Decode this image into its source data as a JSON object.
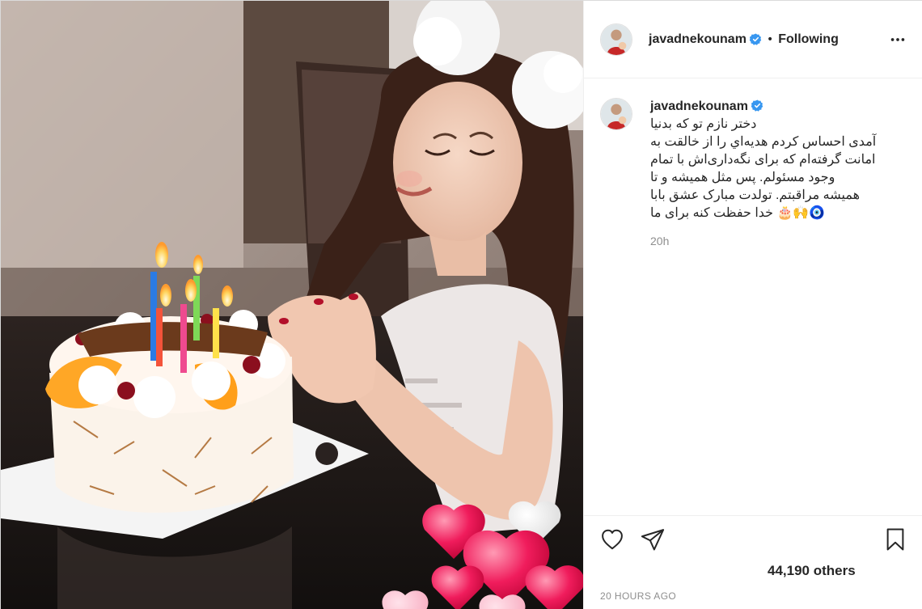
{
  "post": {
    "username": "javadnekounam",
    "header_separator": "•",
    "follow_state": "Following",
    "more_icon": "more-horizontal-icon",
    "verified_icon": "verified-badge-icon",
    "caption": {
      "username": "javadnekounam",
      "lines": [
        "دختر نازم تو که بدنیا",
        "آمدی احساس کردم هدیه‌اي را از خالقت به",
        "امانت گرفته‌ام که برای نگه‌داری‌اش با تمام",
        "وجود مسئولم. پس مثل همیشه و تا",
        "همیشه مراقبتم. تولدت مبارک عشق بابا",
        "🧿🙌🎂 خدا حفظت کنه برای ما"
      ],
      "time": "20h"
    },
    "actions": {
      "like_icon": "heart-icon",
      "share_icon": "paper-plane-icon",
      "save_icon": "bookmark-icon"
    },
    "likes": "44,190 others",
    "date": "20 HOURS AGO",
    "colors": {
      "verified_blue": "#3897f0",
      "text_primary": "#262626",
      "text_secondary": "#8e8e8e",
      "divider": "#efefef"
    }
  }
}
